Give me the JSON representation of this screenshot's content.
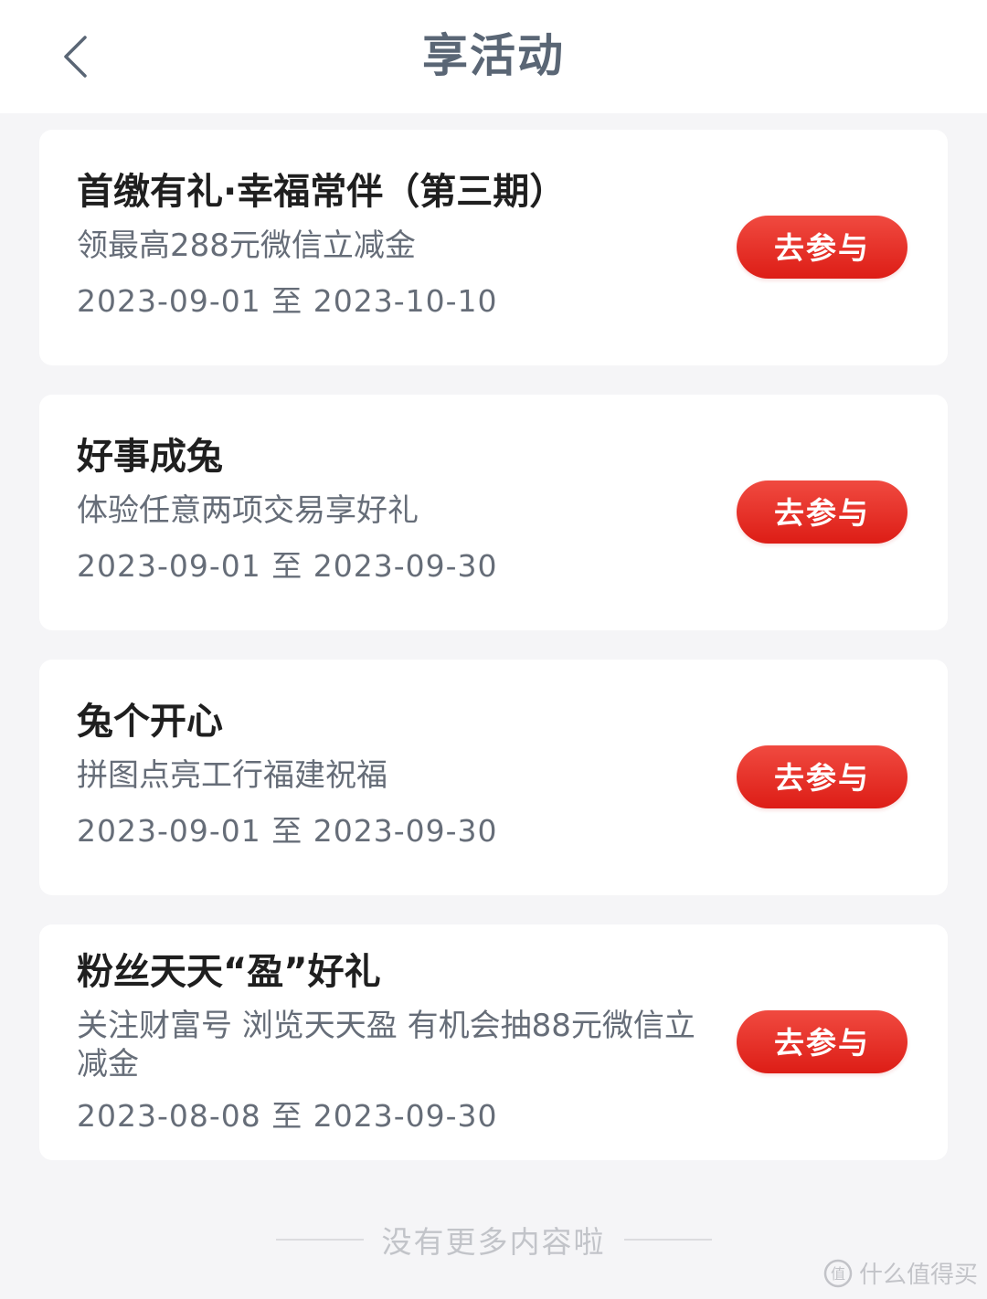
{
  "header": {
    "title": "享活动",
    "back_icon": "chevron-left-icon"
  },
  "activities": [
    {
      "title": "首缴有礼·幸福常伴（第三期）",
      "description": "领最高288元微信立减金",
      "date_range": "2023-09-01 至 2023-10-10",
      "button_label": "去参与"
    },
    {
      "title": "好事成兔",
      "description": "体验任意两项交易享好礼",
      "date_range": "2023-09-01 至 2023-09-30",
      "button_label": "去参与"
    },
    {
      "title": "兔个开心",
      "description": "拼图点亮工行福建祝福",
      "date_range": "2023-09-01 至 2023-09-30",
      "button_label": "去参与"
    },
    {
      "title": "粉丝天天“盈”好礼",
      "description": "关注财富号 浏览天天盈 有机会抽88元微信立减金",
      "date_range": "2023-08-08 至 2023-09-30",
      "button_label": "去参与"
    }
  ],
  "footer": {
    "end_text": "没有更多内容啦"
  },
  "watermark": {
    "text": "什么值得买",
    "icon": "smzdm-logo-icon"
  },
  "colors": {
    "accent": "#e8281f",
    "title_text": "#5a6675",
    "background": "#f5f5f7"
  }
}
